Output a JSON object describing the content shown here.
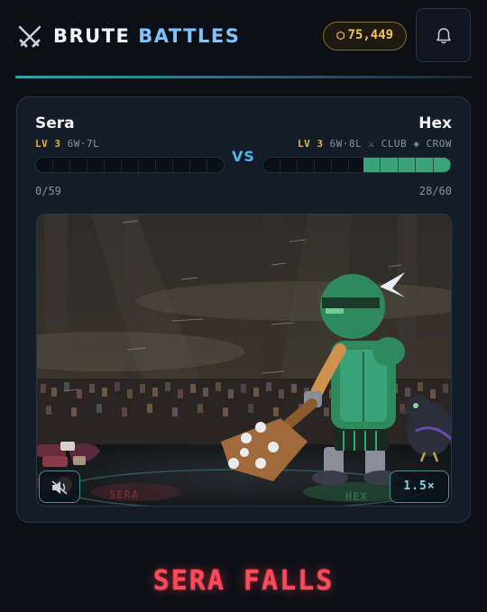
{
  "header": {
    "brand_word1": "BRUTE",
    "brand_word2": "BATTLES",
    "coins": "75,449",
    "coin_icon": "coin-icon",
    "bell_icon": "bell-icon",
    "logo_icon": "crossed-swords-icon"
  },
  "battle": {
    "left": {
      "name": "Sera",
      "level_label": "LV 3",
      "record": "6W·7L",
      "hp_text": "0/59",
      "hp_fraction": 0.0
    },
    "vs_label": "VS",
    "right": {
      "name": "Hex",
      "level_label": "LV 3",
      "record": "6W·8L",
      "weapon": "CLUB",
      "pet": "CROW",
      "hp_text": "28/60",
      "hp_fraction": 0.467
    },
    "arena": {
      "left_ring_label": "SERA",
      "right_ring_label": "HEX",
      "speed_label": "1.5×",
      "mute_icon": "speaker-muted-icon"
    }
  },
  "result_text": "SERA FALLS",
  "colors": {
    "accent_blue": "#7fc4ff",
    "gold": "#e4b33c",
    "hp_green": "#3aa37a",
    "defeat_red": "#ff4a5c"
  }
}
